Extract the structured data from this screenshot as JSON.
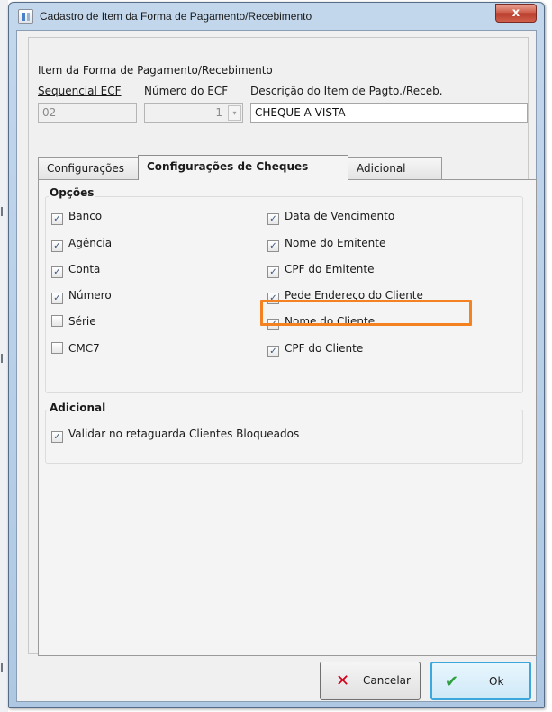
{
  "window": {
    "title": "Cadastro de Item da Forma de Pagamento/Recebimento",
    "close_glyph": "x"
  },
  "header": {
    "section_label": "Item da Forma de Pagamento/Recebimento",
    "sequencial_label": "Sequencial ECF",
    "numero_label": "Número do ECF",
    "descricao_label": "Descrição do Item de Pagto./Receb.",
    "sequencial_value": "02",
    "numero_value": "1",
    "descricao_value": "CHEQUE A VISTA"
  },
  "tabs": [
    {
      "label": "Configurações",
      "active": false
    },
    {
      "label": "Configurações de Cheques",
      "active": true
    },
    {
      "label": "Adicional",
      "active": false
    }
  ],
  "opcoes": {
    "title": "Opções",
    "left": [
      {
        "label": "Banco",
        "checked": true
      },
      {
        "label": "Agência",
        "checked": true
      },
      {
        "label": "Conta",
        "checked": true
      },
      {
        "label": "Número",
        "checked": true
      },
      {
        "label": "Série",
        "checked": false
      },
      {
        "label": "CMC7",
        "checked": false
      }
    ],
    "right": [
      {
        "label": "Data de Vencimento",
        "checked": true
      },
      {
        "label": "Nome do Emitente",
        "checked": true
      },
      {
        "label": "CPF do Emitente",
        "checked": true
      },
      {
        "label": "Pede Endereço do Cliente",
        "checked": true
      },
      {
        "label": "Nome do Cliente",
        "checked": true
      },
      {
        "label": "CPF do Cliente",
        "checked": true
      }
    ]
  },
  "adicional": {
    "title": "Adicional",
    "items": [
      {
        "label": "Validar no retaguarda Clientes Bloqueados",
        "checked": true
      }
    ]
  },
  "buttons": {
    "cancel": "Cancelar",
    "ok": "Ok"
  },
  "colors": {
    "highlight": "#f58220",
    "cancel_icon": "#d0021b",
    "ok_icon": "#2e9e3e"
  }
}
